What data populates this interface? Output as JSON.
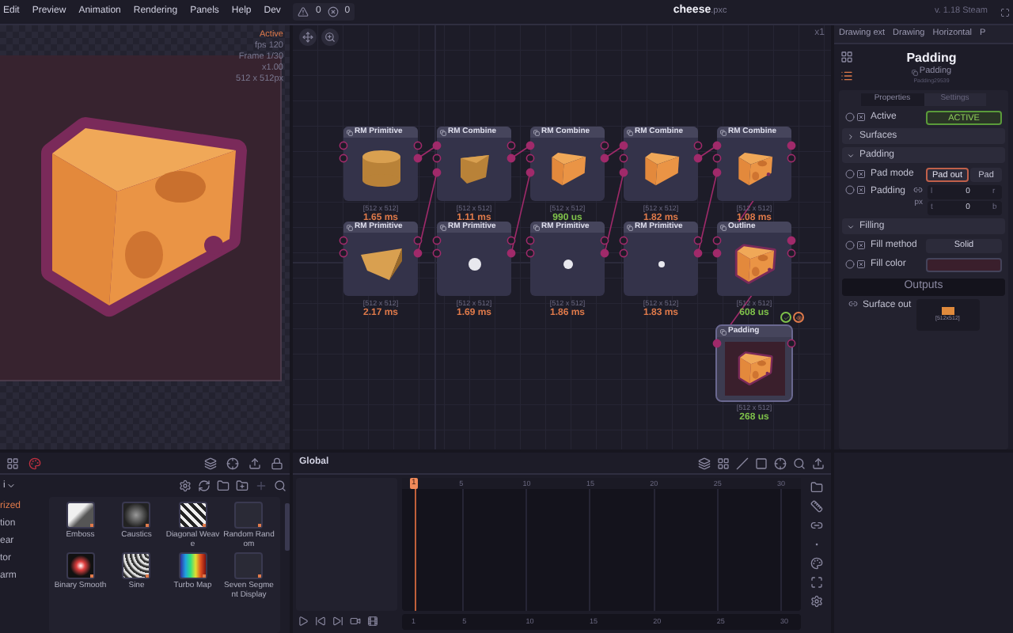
{
  "menu": {
    "items": [
      "Edit",
      "Preview",
      "Animation",
      "Rendering",
      "Panels",
      "Help",
      "Dev"
    ],
    "warnings": "0",
    "errors": "0"
  },
  "title": {
    "name": "cheese",
    "extension": ".pxc"
  },
  "version": "v. 1.18 Steam",
  "preview": {
    "status": "Active",
    "info": [
      "fps 120",
      "Frame 1/30",
      "x1.00",
      "512 x 512px"
    ]
  },
  "graph": {
    "zoom": "x1",
    "columns": [
      {
        "nodes": [
          {
            "kind": "primitive",
            "title": "RM Primitive",
            "thumbnail": {
              "kind": "cylinder"
            },
            "size": "[512 x 512]",
            "time": "1.65 ms",
            "color": "#e07a4a",
            "selected": false
          },
          {
            "kind": "primitive",
            "title": "RM Primitive",
            "thumbnail": {
              "kind": "prism"
            },
            "size": "[512 x 512]",
            "time": "2.17 ms",
            "color": "#e07a4a",
            "selected": false
          }
        ]
      },
      {
        "nodes": [
          {
            "kind": "combine",
            "title": "RM Combine",
            "thumbnail": {
              "kind": "wedge"
            },
            "size": "[512 x 512]",
            "time": "1.11 ms",
            "color": "#e07a4a",
            "selected": false
          },
          {
            "kind": "primitive",
            "title": "RM Primitive",
            "thumbnail": {
              "kind": "sphere"
            },
            "size": "[512 x 512]",
            "time": "1.69 ms",
            "color": "#e07a4a",
            "selected": false
          }
        ]
      },
      {
        "nodes": [
          {
            "kind": "combine",
            "title": "RM Combine",
            "thumbnail": {
              "kind": "cheese"
            },
            "size": "[512 x 512]",
            "time": "990 us",
            "color": "#7fc24a",
            "selected": false
          },
          {
            "kind": "primitive",
            "title": "RM Primitive",
            "thumbnail": {
              "kind": "small-sphere"
            },
            "size": "[512 x 512]",
            "time": "1.86 ms",
            "color": "#e07a4a",
            "selected": false
          }
        ]
      },
      {
        "nodes": [
          {
            "kind": "combine",
            "title": "RM Combine",
            "thumbnail": {
              "kind": "cheese"
            },
            "size": "[512 x 512]",
            "time": "1.82 ms",
            "color": "#e07a4a",
            "selected": false
          },
          {
            "kind": "primitive",
            "title": "RM Primitive",
            "thumbnail": {
              "kind": "dot"
            },
            "size": "[512 x 512]",
            "time": "1.83 ms",
            "color": "#e07a4a",
            "selected": false
          }
        ]
      },
      {
        "nodes": [
          {
            "kind": "combine",
            "title": "RM Combine",
            "thumbnail": {
              "kind": "cheese-holes"
            },
            "size": "[512 x 512]",
            "time": "1.08 ms",
            "color": "#e07a4a",
            "selected": false
          },
          {
            "kind": "outline",
            "title": "Outline",
            "thumbnail": {
              "kind": "outline"
            },
            "size": "[512 x 512]",
            "time": "608 us",
            "color": "#7fc24a",
            "selected": false
          },
          {
            "kind": "padding",
            "title": "Padding",
            "thumbnail": {
              "kind": "padding"
            },
            "size": "[512 x 512]",
            "time": "268 us",
            "color": "#7fc24a",
            "selected": true
          }
        ]
      }
    ]
  },
  "panel_tabs": [
    "Drawing ext",
    "Drawing",
    "Horizontal",
    "P"
  ],
  "inspector": {
    "title": "Padding",
    "subtitle": "Padding",
    "node_id": "Padding29539",
    "tabs": [
      {
        "label": "Properties",
        "selected": true
      },
      {
        "label": "Settings",
        "selected": false
      }
    ],
    "items": [
      {
        "kind": "toggle",
        "label": "Active",
        "value": "ACTIVE",
        "on": true
      },
      {
        "kind": "section",
        "label": "Surfaces",
        "expanded": false
      },
      {
        "kind": "section",
        "label": "Padding",
        "expanded": true
      },
      {
        "kind": "choice",
        "label": "Pad mode",
        "options": [
          {
            "label": "Pad out",
            "selected": true
          },
          {
            "label": "Pad",
            "selected": false
          }
        ]
      },
      {
        "kind": "padding",
        "label": "Padding",
        "unit": "px",
        "fields": [
          {
            "prefix": "l",
            "value": "0",
            "suffix": "r"
          },
          {
            "prefix": "t",
            "value": "0",
            "suffix": "b"
          }
        ]
      },
      {
        "kind": "section",
        "label": "Filling",
        "expanded": true
      },
      {
        "kind": "dropdown",
        "label": "Fill method",
        "value": "Solid"
      },
      {
        "kind": "color",
        "label": "Fill color",
        "color": "#3a1f2c"
      }
    ],
    "outputs": {
      "title": "Outputs",
      "items": [
        {
          "label": "Surface out",
          "size": "[512x512]"
        }
      ]
    }
  },
  "collections": {
    "folder": "i",
    "categories": [
      {
        "label": "rized",
        "selected": true
      },
      {
        "label": "tion",
        "selected": false
      },
      {
        "label": "ear",
        "selected": false
      },
      {
        "label": "tor",
        "selected": false
      },
      {
        "label": "arm",
        "selected": false
      }
    ],
    "items": [
      {
        "label": "Emboss",
        "thumbnail": {
          "kind": "emboss"
        }
      },
      {
        "label": "Caustics",
        "thumbnail": {
          "kind": "caustics"
        }
      },
      {
        "label": "Diagonal Weave",
        "thumbnail": {
          "kind": "weave"
        }
      },
      {
        "label": "Random Random",
        "thumbnail": {
          "kind": "random"
        }
      },
      {
        "label": "Binary Smooth",
        "thumbnail": {
          "kind": "binary"
        }
      },
      {
        "label": "Sine",
        "thumbnail": {
          "kind": "sine"
        }
      },
      {
        "label": "Turbo Map",
        "thumbnail": {
          "kind": "turbo"
        }
      },
      {
        "label": "Seven Segment Display",
        "thumbnail": {
          "kind": "segment"
        }
      }
    ]
  },
  "timeline": {
    "label": "Global",
    "current_frame": "1",
    "ticks": [
      "5",
      "10",
      "15",
      "20",
      "25",
      "30"
    ],
    "bottom_ticks": [
      "1",
      "5",
      "10",
      "15",
      "20",
      "25",
      "30"
    ]
  }
}
